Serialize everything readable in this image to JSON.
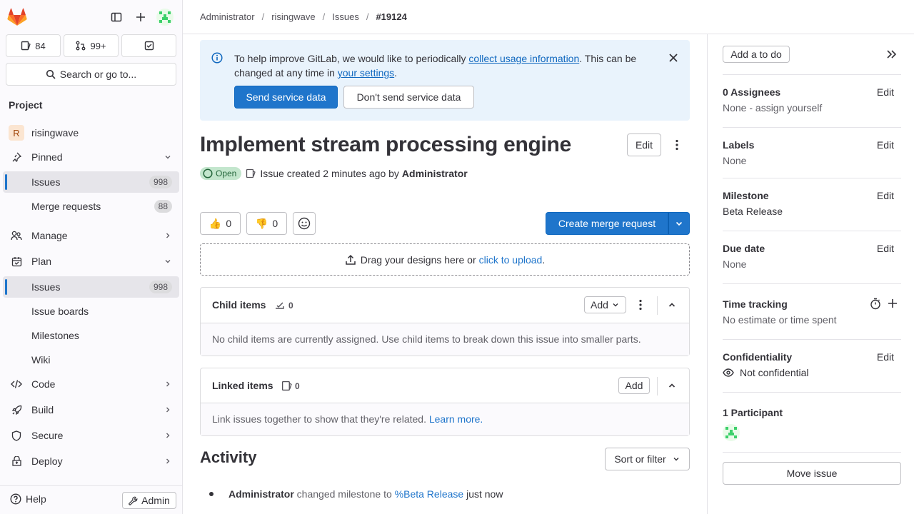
{
  "sidebar": {
    "counts": {
      "issues": "84",
      "merge_requests": "99+"
    },
    "search_label": "Search or go to...",
    "section_title": "Project",
    "project_name": "risingwave",
    "project_initial": "R",
    "pinned_label": "Pinned",
    "pinned_items": [
      {
        "label": "Issues",
        "badge": "998"
      },
      {
        "label": "Merge requests",
        "badge": "88"
      }
    ],
    "manage_label": "Manage",
    "plan_label": "Plan",
    "plan_items": [
      {
        "label": "Issues",
        "badge": "998"
      },
      {
        "label": "Issue boards"
      },
      {
        "label": "Milestones"
      },
      {
        "label": "Wiki"
      }
    ],
    "code_label": "Code",
    "build_label": "Build",
    "secure_label": "Secure",
    "deploy_label": "Deploy",
    "help_label": "Help",
    "admin_label": "Admin"
  },
  "breadcrumb": [
    "Administrator",
    "risingwave",
    "Issues",
    "#19124"
  ],
  "alert": {
    "text_1": "To help improve GitLab, we would like to periodically ",
    "link_1": "collect usage information",
    "text_2": ". This can be changed at any time in ",
    "link_2": "your settings",
    "text_3": ".",
    "send_btn": "Send service data",
    "dont_btn": "Don't send service data"
  },
  "issue": {
    "title": "Implement stream processing engine",
    "edit_label": "Edit",
    "status": "Open",
    "meta_prefix": "Issue created 2 minutes ago by ",
    "author": "Administrator",
    "thumbs_up": "0",
    "thumbs_down": "0",
    "create_mr": "Create merge request",
    "drop_text": "Drag your designs here or ",
    "drop_link": "click to upload",
    "drop_end": "."
  },
  "child_items": {
    "title": "Child items",
    "count": "0",
    "add": "Add",
    "empty": "No child items are currently assigned. Use child items to break down this issue into smaller parts."
  },
  "linked_items": {
    "title": "Linked items",
    "count": "0",
    "add": "Add",
    "empty": "Link issues together to show that they're related. ",
    "learn_more": "Learn more."
  },
  "activity": {
    "title": "Activity",
    "sort_label": "Sort or filter",
    "entry_author": "Administrator",
    "entry_text": " changed milestone to ",
    "entry_link": "%Beta Release",
    "entry_time": " just now"
  },
  "right": {
    "todo": "Add a to do",
    "assignees_title": "0 Assignees",
    "assignees_value": "None - assign yourself",
    "labels_title": "Labels",
    "labels_value": "None",
    "milestone_title": "Milestone",
    "milestone_value": "Beta Release",
    "due_title": "Due date",
    "due_value": "None",
    "time_title": "Time tracking",
    "time_value": "No estimate or time spent",
    "conf_title": "Confidentiality",
    "conf_value": "Not confidential",
    "participants_title": "1 Participant",
    "edit": "Edit",
    "move": "Move issue"
  },
  "colors": {
    "brand": "#e24329",
    "accent": "#1f75cb",
    "open": "#24663b"
  }
}
